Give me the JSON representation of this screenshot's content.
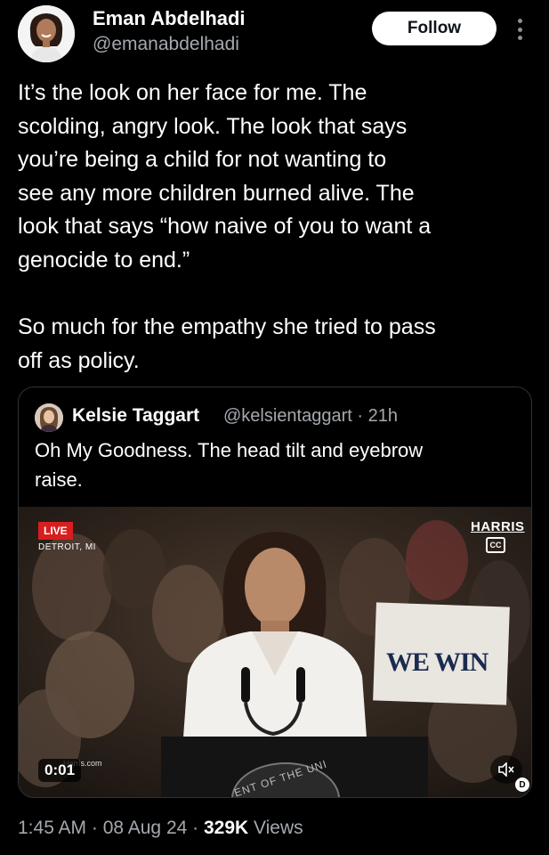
{
  "author": {
    "name": "Eman Abdelhadi",
    "handle": "@emanabdelhadi",
    "avatar_icon": "profile-photo"
  },
  "follow_label": "Follow",
  "more_icon": "vertical-ellipsis-icon",
  "tweet_text": "It’s the look on her face for me. The\nscolding, angry look. The look that says\nyou’re being a child for not wanting to\nsee any more children burned alive. The\nlook that says “how naive of you to want a\ngenocide to end.”\n\nSo much for the empathy she tried to pass\noff as policy.",
  "quote": {
    "name": "Kelsie Taggart",
    "meta": "@kelsientaggart · 21h",
    "text": "Oh My Goodness. The head tilt and eyebrow\nraise.",
    "video": {
      "live_label": "LIVE",
      "location": "DETROIT, MI",
      "channel_logo": "HARRIS",
      "cc_label": "CC",
      "sign_text": "WE WIN",
      "watermark": "Harris.com",
      "seal_text": "ENT OF THE UNI",
      "time": "0:01",
      "mute_icon": "speaker-muted-icon",
      "badge": "D"
    }
  },
  "footer": {
    "time": "1:45 AM · 08 Aug 24 · ",
    "views": "329K",
    "views_label": " Views"
  },
  "colors": {
    "background": "#000000",
    "text": "#ffffff",
    "secondary": "#a4a9ae",
    "border": "#2f3336",
    "live": "#d81e1e"
  }
}
